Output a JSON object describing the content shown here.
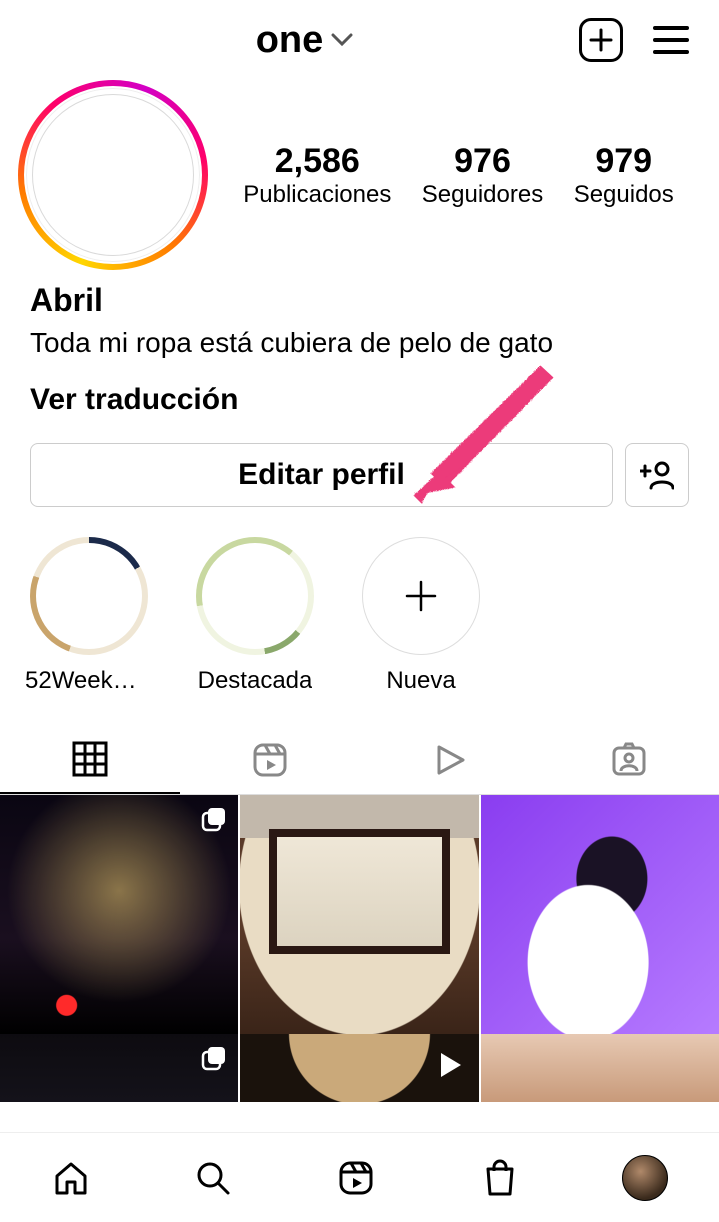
{
  "header": {
    "username": "one"
  },
  "profile": {
    "stats": {
      "posts": {
        "count": "2,586",
        "label": "Publicaciones"
      },
      "followers": {
        "count": "976",
        "label": "Seguidores"
      },
      "following": {
        "count": "979",
        "label": "Seguidos"
      }
    },
    "display_name": "Abril",
    "bio": "Toda mi ropa está cubiera de pelo de gato",
    "translate": "Ver traducción"
  },
  "buttons": {
    "edit_profile": "Editar perfil"
  },
  "highlights": [
    {
      "label": "52WeekWri..."
    },
    {
      "label": "Destacada"
    },
    {
      "label": "Nueva"
    }
  ],
  "tabs": {
    "grid": "grid",
    "reels": "reels",
    "video": "video",
    "tagged": "tagged",
    "active": "grid"
  },
  "grid_posts": [
    {
      "multi": true,
      "video": false
    },
    {
      "multi": false,
      "video": false
    },
    {
      "multi": false,
      "video": false
    },
    {
      "multi": true,
      "video": false
    },
    {
      "multi": false,
      "video": true
    },
    {
      "multi": false,
      "video": false
    }
  ],
  "annotation": {
    "type": "arrow",
    "target": "edit-profile-button",
    "color": "#ec3a7a"
  }
}
